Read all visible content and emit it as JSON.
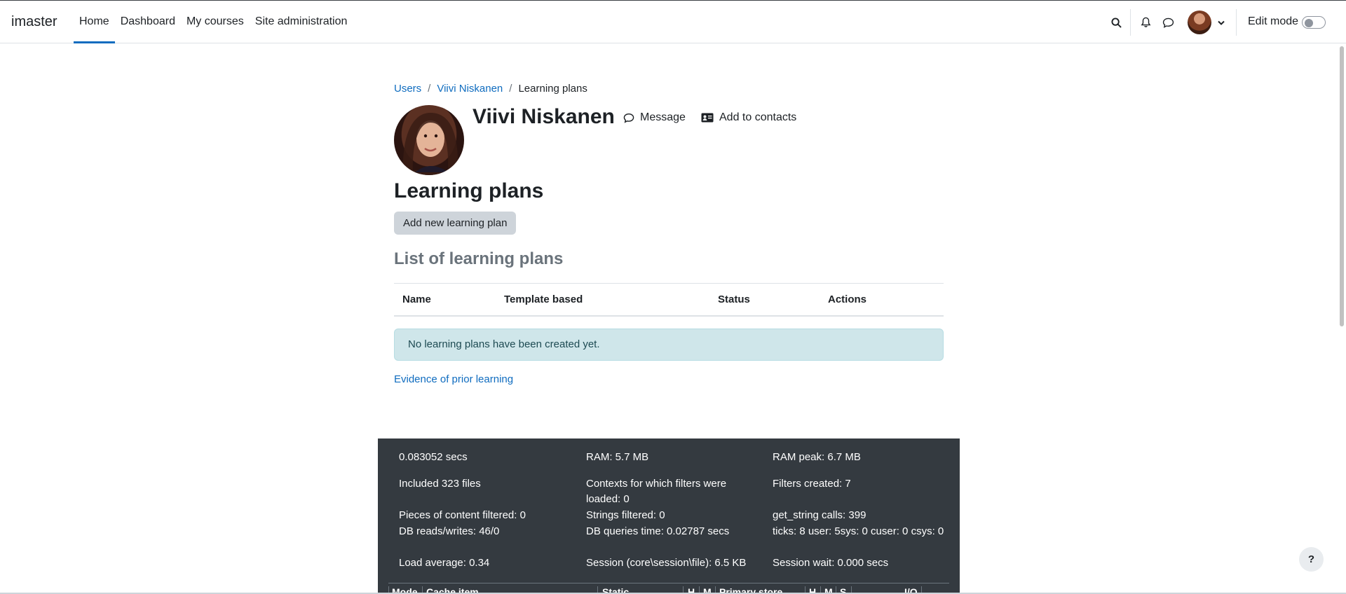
{
  "navbar": {
    "brand": "imaster",
    "links": [
      "Home",
      "Dashboard",
      "My courses",
      "Site administration"
    ],
    "edit_mode_label": "Edit mode"
  },
  "breadcrumb": {
    "items": [
      "Users",
      "Viivi Niskanen",
      "Learning plans"
    ]
  },
  "profile": {
    "name": "Viivi Niskanen",
    "message_label": "Message",
    "add_contact_label": "Add to contacts"
  },
  "page": {
    "title": "Learning plans",
    "add_button": "Add new learning plan",
    "list_title": "List of learning plans",
    "columns": [
      "Name",
      "Template based",
      "Status",
      "Actions"
    ],
    "empty_message": "No learning plans have been created yet.",
    "evidence_link": "Evidence of prior learning"
  },
  "perf": {
    "time": "0.083052 secs",
    "ram": "RAM: 5.7 MB",
    "ram_peak": "RAM peak: 6.7 MB",
    "included": "Included 323 files",
    "contexts": "Contexts for which filters were loaded: 0",
    "filters_created": "Filters created: 7",
    "pieces": "Pieces of content filtered: 0",
    "strings": "Strings filtered: 0",
    "get_string": "get_string calls: 399",
    "db_rw": "DB reads/writes: 46/0",
    "db_time": "DB queries time: 0.02787 secs",
    "ticks": "ticks: 8 user: 5sys: 0 cuser: 0 csys: 0",
    "load": "Load average: 0.34",
    "session": "Session (core\\session\\file): 6.5 KB",
    "session_wait": "Session wait: 0.000 secs",
    "cache_headers": [
      "Mode",
      "Cache item",
      "Static",
      "H",
      "M",
      "Primary store",
      "H",
      "M",
      "S",
      "I/O"
    ]
  },
  "help_label": "?"
}
